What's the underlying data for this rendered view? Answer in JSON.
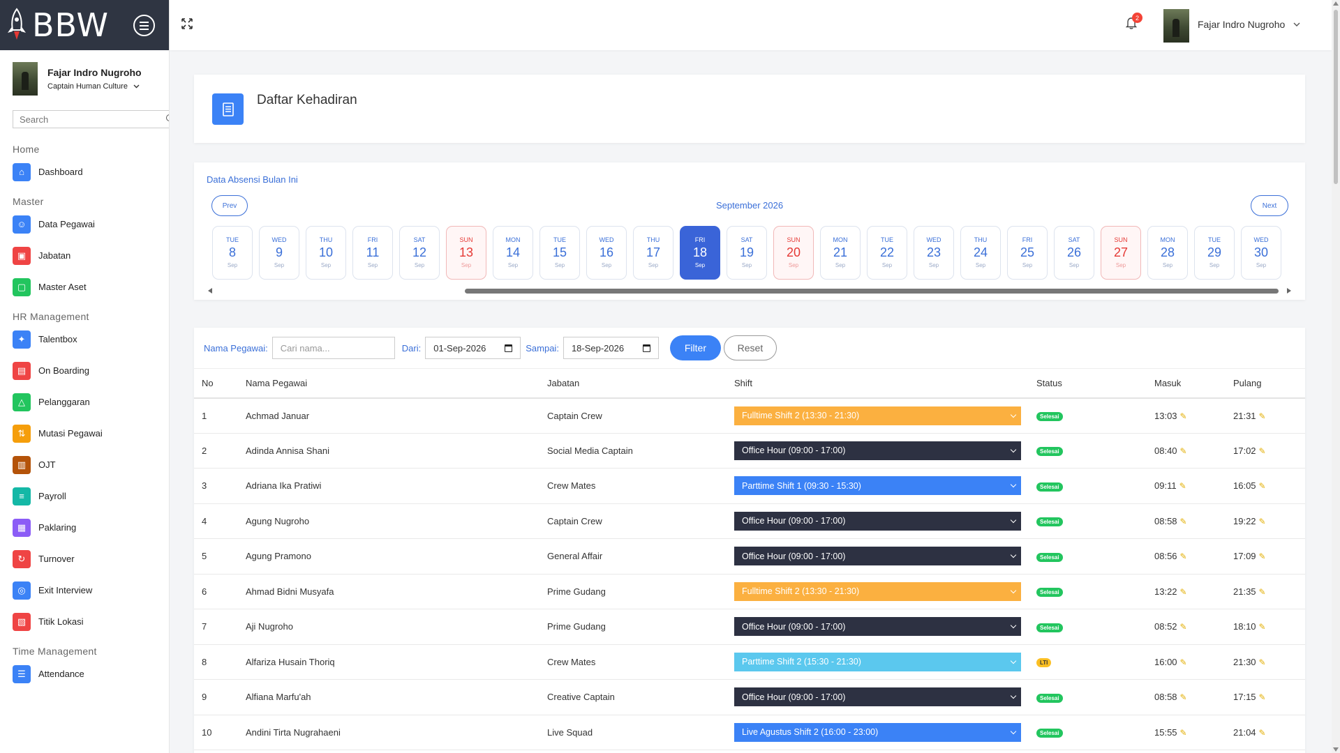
{
  "brand": {
    "name": "BBW"
  },
  "user": {
    "name": "Fajar Indro Nugroho",
    "role": "Captain Human Culture"
  },
  "sidebar": {
    "search_placeholder": "Search",
    "sections": [
      {
        "title": "Home",
        "items": [
          {
            "label": "Dashboard",
            "icon": "home-icon",
            "color": "#3b82f6"
          }
        ]
      },
      {
        "title": "Master",
        "items": [
          {
            "label": "Data Pegawai",
            "icon": "user-icon",
            "color": "#3b82f6"
          },
          {
            "label": "Jabatan",
            "icon": "briefcase-icon",
            "color": "#ef4444"
          },
          {
            "label": "Master Aset",
            "icon": "box-icon",
            "color": "#22c55e"
          }
        ]
      },
      {
        "title": "HR Management",
        "items": [
          {
            "label": "Talentbox",
            "icon": "bulb-icon",
            "color": "#3b82f6"
          },
          {
            "label": "On Boarding",
            "icon": "clipboard-icon",
            "color": "#ef4444"
          },
          {
            "label": "Pelanggaran",
            "icon": "warning-icon",
            "color": "#22c55e"
          },
          {
            "label": "Mutasi Pegawai",
            "icon": "swap-icon",
            "color": "#f59e0b"
          },
          {
            "label": "OJT",
            "icon": "book-icon",
            "color": "#b45309"
          },
          {
            "label": "Payroll",
            "icon": "receipt-icon",
            "color": "#14b8a6"
          },
          {
            "label": "Paklaring",
            "icon": "archive-icon",
            "color": "#8b5cf6"
          },
          {
            "label": "Turnover",
            "icon": "redo-icon",
            "color": "#ef4444"
          },
          {
            "label": "Exit Interview",
            "icon": "chat-icon",
            "color": "#3b82f6"
          },
          {
            "label": "Titik Lokasi",
            "icon": "map-icon",
            "color": "#ef4444"
          }
        ]
      },
      {
        "title": "Time Management",
        "items": [
          {
            "label": "Attendance",
            "icon": "list-icon",
            "color": "#3b82f6"
          }
        ]
      }
    ]
  },
  "topbar": {
    "notification_count": "2",
    "user_name": "Fajar Indro Nugroho"
  },
  "page": {
    "title": "Daftar Kehadiran"
  },
  "calendar": {
    "heading": "Data Absensi Bulan Ini",
    "prev_label": "Prev",
    "next_label": "Next",
    "month_label": "September 2026",
    "days": [
      {
        "dow": "TUE",
        "num": "8",
        "mon": "Sep",
        "type": "normal"
      },
      {
        "dow": "WED",
        "num": "9",
        "mon": "Sep",
        "type": "normal"
      },
      {
        "dow": "THU",
        "num": "10",
        "mon": "Sep",
        "type": "normal"
      },
      {
        "dow": "FRI",
        "num": "11",
        "mon": "Sep",
        "type": "normal"
      },
      {
        "dow": "SAT",
        "num": "12",
        "mon": "Sep",
        "type": "normal"
      },
      {
        "dow": "SUN",
        "num": "13",
        "mon": "Sep",
        "type": "sun"
      },
      {
        "dow": "MON",
        "num": "14",
        "mon": "Sep",
        "type": "normal"
      },
      {
        "dow": "TUE",
        "num": "15",
        "mon": "Sep",
        "type": "normal"
      },
      {
        "dow": "WED",
        "num": "16",
        "mon": "Sep",
        "type": "normal"
      },
      {
        "dow": "THU",
        "num": "17",
        "mon": "Sep",
        "type": "normal"
      },
      {
        "dow": "FRI",
        "num": "18",
        "mon": "Sep",
        "type": "active"
      },
      {
        "dow": "SAT",
        "num": "19",
        "mon": "Sep",
        "type": "normal"
      },
      {
        "dow": "SUN",
        "num": "20",
        "mon": "Sep",
        "type": "sun"
      },
      {
        "dow": "MON",
        "num": "21",
        "mon": "Sep",
        "type": "normal"
      },
      {
        "dow": "TUE",
        "num": "22",
        "mon": "Sep",
        "type": "normal"
      },
      {
        "dow": "WED",
        "num": "23",
        "mon": "Sep",
        "type": "normal"
      },
      {
        "dow": "THU",
        "num": "24",
        "mon": "Sep",
        "type": "normal"
      },
      {
        "dow": "FRI",
        "num": "25",
        "mon": "Sep",
        "type": "normal"
      },
      {
        "dow": "SAT",
        "num": "26",
        "mon": "Sep",
        "type": "normal"
      },
      {
        "dow": "SUN",
        "num": "27",
        "mon": "Sep",
        "type": "sun"
      },
      {
        "dow": "MON",
        "num": "28",
        "mon": "Sep",
        "type": "normal"
      },
      {
        "dow": "TUE",
        "num": "29",
        "mon": "Sep",
        "type": "normal"
      },
      {
        "dow": "WED",
        "num": "30",
        "mon": "Sep",
        "type": "normal"
      }
    ]
  },
  "filters": {
    "name_label": "Nama Pegawai:",
    "name_placeholder": "Cari nama...",
    "from_label": "Dari:",
    "from_value": "01-Sep-2026",
    "to_label": "Sampai:",
    "to_value": "18-Sep-2026",
    "filter_label": "Filter",
    "reset_label": "Reset"
  },
  "table": {
    "columns": [
      "No",
      "Nama Pegawai",
      "Jabatan",
      "Shift",
      "Status",
      "Masuk",
      "Pulang"
    ],
    "rows": [
      {
        "no": "1",
        "name": "Achmad Januar",
        "jabatan": "Captain Crew",
        "shift": "Fulltime Shift 2 (13:30 - 21:30)",
        "shift_color": "#fbb040",
        "status": "Selesai",
        "status_color": "#22c55e",
        "status_text_color": "#ffffff",
        "masuk": "13:03",
        "pulang": "21:31"
      },
      {
        "no": "2",
        "name": "Adinda Annisa Shani",
        "jabatan": "Social Media Captain",
        "shift": "Office Hour (09:00 - 17:00)",
        "shift_color": "#2d3142",
        "status": "Selesai",
        "status_color": "#22c55e",
        "status_text_color": "#ffffff",
        "masuk": "08:40",
        "pulang": "17:02"
      },
      {
        "no": "3",
        "name": "Adriana Ika Pratiwi",
        "jabatan": "Crew Mates",
        "shift": "Parttime Shift 1 (09:30 - 15:30)",
        "shift_color": "#3b82f6",
        "status": "Selesai",
        "status_color": "#22c55e",
        "status_text_color": "#ffffff",
        "masuk": "09:11",
        "pulang": "16:05"
      },
      {
        "no": "4",
        "name": "Agung Nugroho",
        "jabatan": "Captain Crew",
        "shift": "Office Hour (09:00 - 17:00)",
        "shift_color": "#2d3142",
        "status": "Selesai",
        "status_color": "#22c55e",
        "status_text_color": "#ffffff",
        "masuk": "08:58",
        "pulang": "19:22"
      },
      {
        "no": "5",
        "name": "Agung Pramono",
        "jabatan": "General Affair",
        "shift": "Office Hour (09:00 - 17:00)",
        "shift_color": "#2d3142",
        "status": "Selesai",
        "status_color": "#22c55e",
        "status_text_color": "#ffffff",
        "masuk": "08:56",
        "pulang": "17:09"
      },
      {
        "no": "6",
        "name": "Ahmad Bidni Musyafa",
        "jabatan": "Prime Gudang",
        "shift": "Fulltime Shift 2 (13:30 - 21:30)",
        "shift_color": "#fbb040",
        "status": "Selesai",
        "status_color": "#22c55e",
        "status_text_color": "#ffffff",
        "masuk": "13:22",
        "pulang": "21:35"
      },
      {
        "no": "7",
        "name": "Aji Nugroho",
        "jabatan": "Prime Gudang",
        "shift": "Office Hour (09:00 - 17:00)",
        "shift_color": "#2d3142",
        "status": "Selesai",
        "status_color": "#22c55e",
        "status_text_color": "#ffffff",
        "masuk": "08:52",
        "pulang": "18:10"
      },
      {
        "no": "8",
        "name": "Alfariza Husain Thoriq",
        "jabatan": "Crew Mates",
        "shift": "Parttime Shift 2 (15:30 - 21:30)",
        "shift_color": "#5bc8ee",
        "status": "LTI",
        "status_color": "#fbbf24",
        "status_text_color": "#333333",
        "masuk": "16:00",
        "pulang": "21:30"
      },
      {
        "no": "9",
        "name": "Alfiana Marfu'ah",
        "jabatan": "Creative Captain",
        "shift": "Office Hour (09:00 - 17:00)",
        "shift_color": "#2d3142",
        "status": "Selesai",
        "status_color": "#22c55e",
        "status_text_color": "#ffffff",
        "masuk": "08:58",
        "pulang": "17:15"
      },
      {
        "no": "10",
        "name": "Andini Tirta Nugrahaeni",
        "jabatan": "Live Squad",
        "shift": "Live Agustus Shift 2 (16:00 - 23:00)",
        "shift_color": "#3b82f6",
        "status": "Selesai",
        "status_color": "#22c55e",
        "status_text_color": "#ffffff",
        "masuk": "15:55",
        "pulang": "21:04"
      }
    ]
  }
}
